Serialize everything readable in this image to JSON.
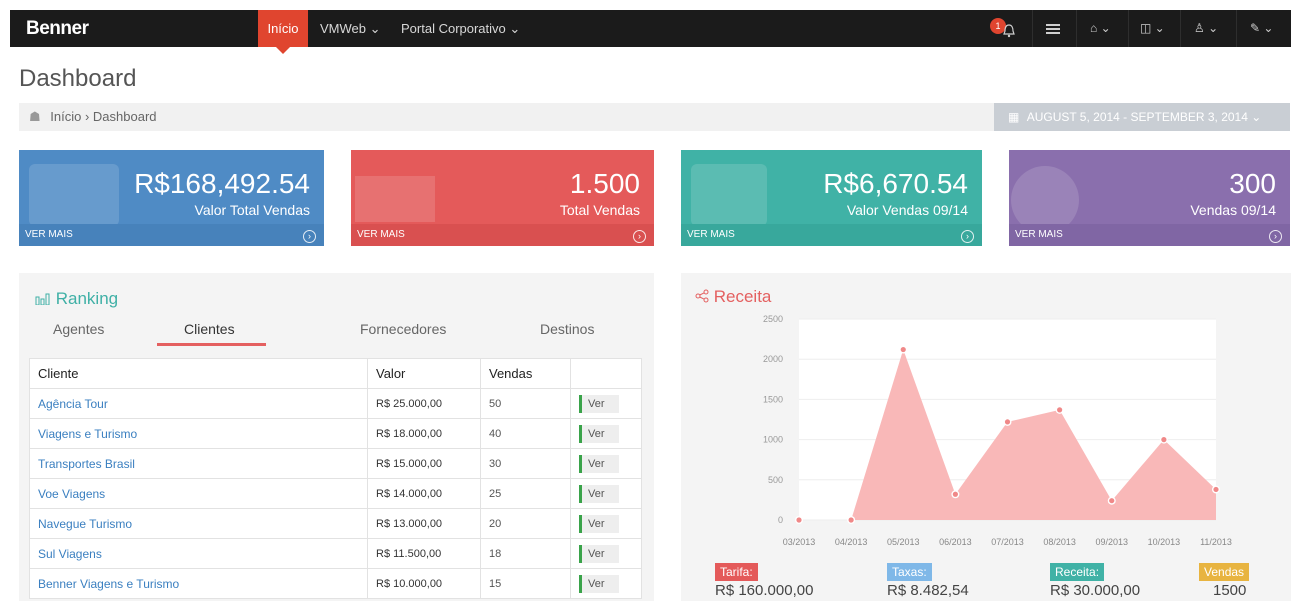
{
  "nav": {
    "brand": "Benner",
    "active": "Início",
    "items": [
      "VMWeb ⌄",
      "Portal Corporativo ⌄"
    ],
    "notification_count": "1"
  },
  "page": {
    "title": "Dashboard",
    "breadcrumb": "Início  ›  Dashboard",
    "date_range": "AUGUST 5, 2014 - SEPTEMBER 3, 2014 ⌄"
  },
  "tiles": [
    {
      "value": "R$168,492.54",
      "label": "Valor Total Vendas",
      "more": "VER MAIS",
      "color": "#4f8bc5"
    },
    {
      "value": "1.500",
      "label": "Total Vendas",
      "more": "VER MAIS",
      "color": "#e45a5a"
    },
    {
      "value": "R$6,670.54",
      "label": "Valor Vendas 09/14",
      "more": "VER MAIS",
      "color": "#40b2a6"
    },
    {
      "value": "300",
      "label": "Vendas 09/14",
      "more": "VER MAIS",
      "color": "#8a6fad"
    }
  ],
  "ranking": {
    "title": "Ranking",
    "tabs": [
      "Agentes",
      "Clientes",
      "Fornecedores",
      "Destinos"
    ],
    "headers": [
      "Cliente",
      "Valor",
      "Vendas",
      ""
    ],
    "rows": [
      {
        "client": "Agência Tour",
        "value": "R$ 25.000,00",
        "sales": "50",
        "action": "Ver"
      },
      {
        "client": "Viagens e Turismo",
        "value": "R$ 18.000,00",
        "sales": "40",
        "action": "Ver"
      },
      {
        "client": "Transportes Brasil",
        "value": "R$ 15.000,00",
        "sales": "30",
        "action": "Ver"
      },
      {
        "client": "Voe Viagens",
        "value": "R$ 14.000,00",
        "sales": "25",
        "action": "Ver"
      },
      {
        "client": "Navegue Turismo",
        "value": "R$ 13.000,00",
        "sales": "20",
        "action": "Ver"
      },
      {
        "client": "Sul Viagens",
        "value": "R$ 11.500,00",
        "sales": "18",
        "action": "Ver"
      },
      {
        "client": "Benner Viagens e Turismo",
        "value": "R$ 10.000,00",
        "sales": "15",
        "action": "Ver"
      }
    ]
  },
  "receita": {
    "title": "Receita",
    "legend": [
      {
        "label": "Tarifa:",
        "value": "R$ 160.000,00",
        "color": "#e45a5a"
      },
      {
        "label": "Taxas:",
        "value": "R$ 8.482,54",
        "color": "#7fb8e8"
      },
      {
        "label": "Receita:",
        "value": "R$ 30.000,00",
        "color": "#40b2a6"
      },
      {
        "label": "Vendas",
        "value": "1500",
        "color": "#e8b440"
      }
    ]
  },
  "chart_data": {
    "type": "area",
    "title": "Receita",
    "x": [
      "03/2013",
      "04/2013",
      "05/2013",
      "06/2013",
      "07/2013",
      "08/2013",
      "09/2013",
      "10/2013",
      "11/2013"
    ],
    "series": [
      {
        "values": [
          0,
          0,
          2120,
          320,
          1220,
          1370,
          240,
          1000,
          380
        ]
      }
    ],
    "yticks": [
      0,
      500,
      1000,
      1500,
      2000,
      2500
    ],
    "ylim": [
      0,
      2500
    ],
    "grid": true,
    "color": "#f9b8b8"
  }
}
